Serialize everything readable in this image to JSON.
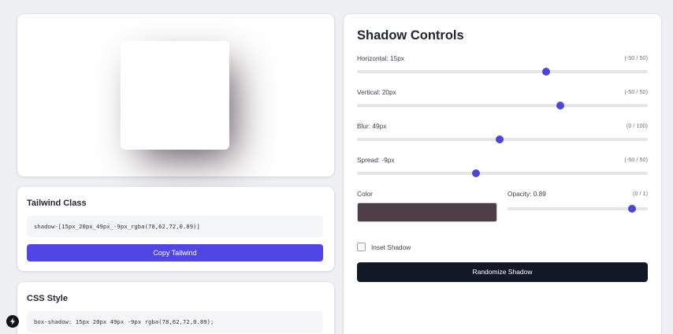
{
  "tailwind": {
    "title": "Tailwind Class",
    "code": "shadow-[15px_20px_49px_-9px_rgba(78,62,72,0.89)]",
    "copy_label": "Copy Tailwind"
  },
  "css": {
    "title": "CSS Style",
    "code": "box-shadow: 15px 20px 49px -9px rgba(78,62,72,0.89);"
  },
  "controls": {
    "title": "Shadow Controls",
    "sliders": [
      {
        "label": "Horizontal: 15px",
        "range": "(-50 / 50)",
        "value": 15,
        "min": -50,
        "max": 50
      },
      {
        "label": "Vertical: 20px",
        "range": "(-50 / 50)",
        "value": 20,
        "min": -50,
        "max": 50
      },
      {
        "label": "Blur: 49px",
        "range": "(0 / 100)",
        "value": 49,
        "min": 0,
        "max": 100
      },
      {
        "label": "Spread: -9px",
        "range": "(-50 / 50)",
        "value": -9,
        "min": -50,
        "max": 50
      }
    ],
    "color_label": "Color",
    "color_value": "#4e3e48",
    "opacity_label": "Opacity: 0.89",
    "opacity_range": "(0 / 1)",
    "opacity_value": 0.89,
    "inset_label": "Inset Shadow",
    "inset_checked": false,
    "randomize_label": "Randomize Shadow"
  },
  "colors": {
    "accent": "#5046e5",
    "slider_thumb": "#4a46d8",
    "dark_button": "#121826"
  }
}
